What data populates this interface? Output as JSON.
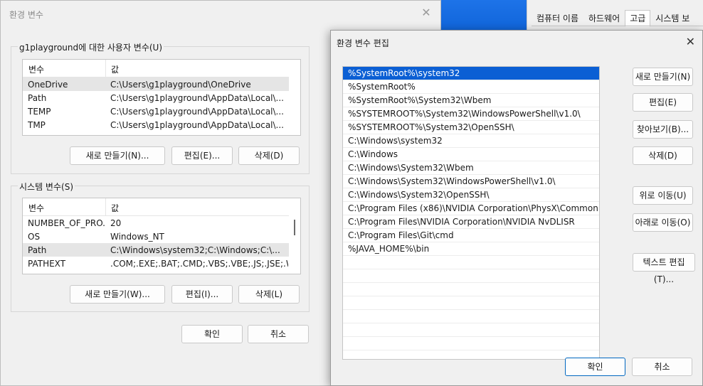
{
  "colors": {
    "accent": "#0b5fd4",
    "dialog_bg": "#f0f0f0",
    "selection": "#0b5fd4"
  },
  "sysprops": {
    "tabs": [
      "컴퓨터 이름",
      "하드웨어",
      "고급",
      "시스템 보"
    ]
  },
  "env": {
    "title": "환경 변수",
    "user_group_title": "g1playground에 대한 사용자 변수(U)",
    "system_group_title": "시스템 변수(S)",
    "col_name": "변수",
    "col_value": "값",
    "user_rows": [
      {
        "name": "OneDrive",
        "value": "C:\\Users\\g1playground\\OneDrive"
      },
      {
        "name": "Path",
        "value": "C:\\Users\\g1playground\\AppData\\Local\\..."
      },
      {
        "name": "TEMP",
        "value": "C:\\Users\\g1playground\\AppData\\Local\\..."
      },
      {
        "name": "TMP",
        "value": "C:\\Users\\g1playground\\AppData\\Local\\..."
      }
    ],
    "system_rows": [
      {
        "name": "NUMBER_OF_PRO...",
        "value": "20"
      },
      {
        "name": "OS",
        "value": "Windows_NT"
      },
      {
        "name": "Path",
        "value": "C:\\Windows\\system32;C:\\Windows;C:\\..."
      },
      {
        "name": "PATHEXT",
        "value": ".COM;.EXE;.BAT;.CMD;.VBS;.VBE;.JS;.JSE;.W..."
      }
    ],
    "user_buttons": {
      "new": "새로 만들기(N)...",
      "edit": "편집(E)...",
      "delete": "삭제(D)"
    },
    "system_buttons": {
      "new": "새로 만들기(W)...",
      "edit": "편집(I)...",
      "delete": "삭제(L)"
    },
    "ok": "확인",
    "cancel": "취소"
  },
  "edit": {
    "title": "환경 변수 편집",
    "paths": [
      "%SystemRoot%\\system32",
      "%SystemRoot%",
      "%SystemRoot%\\System32\\Wbem",
      "%SYSTEMROOT%\\System32\\WindowsPowerShell\\v1.0\\",
      "%SYSTEMROOT%\\System32\\OpenSSH\\",
      "C:\\Windows\\system32",
      "C:\\Windows",
      "C:\\Windows\\System32\\Wbem",
      "C:\\Windows\\System32\\WindowsPowerShell\\v1.0\\",
      "C:\\Windows\\System32\\OpenSSH\\",
      "C:\\Program Files (x86)\\NVIDIA Corporation\\PhysX\\Common",
      "C:\\Program Files\\NVIDIA Corporation\\NVIDIA NvDLISR",
      "C:\\Program Files\\Git\\cmd",
      "%JAVA_HOME%\\bin",
      "",
      "",
      "",
      "",
      "",
      "",
      ""
    ],
    "buttons": {
      "new": "새로 만들기(N)",
      "edit": "편집(E)",
      "browse": "찾아보기(B)...",
      "delete": "삭제(D)",
      "move_up": "위로 이동(U)",
      "move_down": "아래로 이동(O)",
      "edit_text": "텍스트 편집(T)..."
    },
    "ok": "확인",
    "cancel": "취소"
  }
}
